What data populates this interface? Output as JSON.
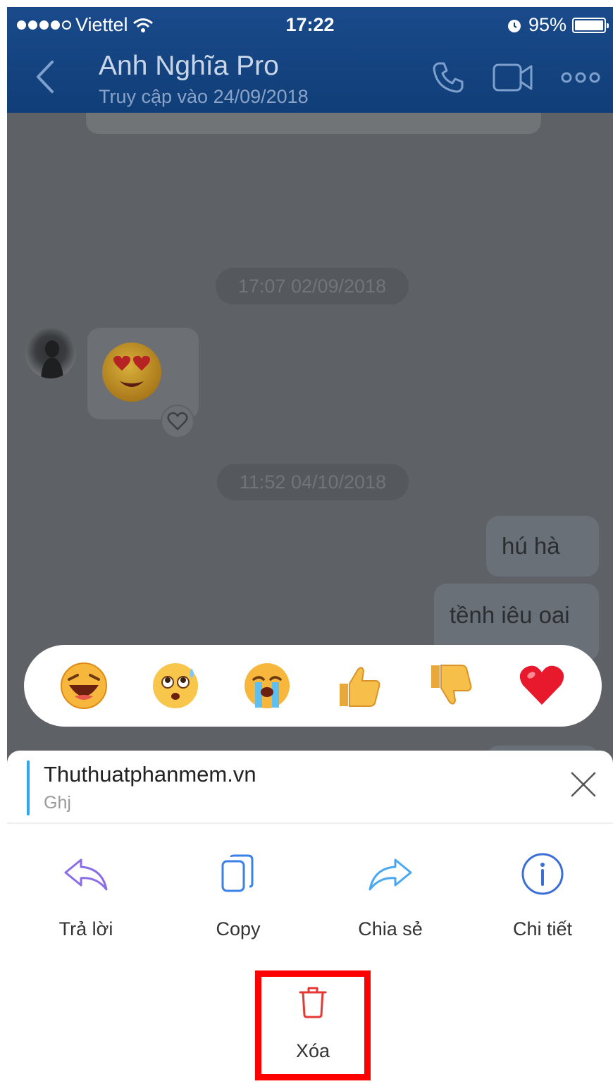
{
  "status_bar": {
    "carrier": "Viettel",
    "time": "17:22",
    "battery": "95%",
    "battery_level": 0.95,
    "icons": [
      "signal-dots-icon",
      "wifi-icon",
      "alarm-icon",
      "battery-icon"
    ]
  },
  "header": {
    "contact_name": "Anh Nghĩa Pro",
    "last_seen": "Truy cập vào 24/09/2018",
    "icons": [
      "back-chevron-icon",
      "phone-icon",
      "video-call-icon",
      "more-icon"
    ]
  },
  "chat": {
    "timestamps": [
      "17:07 02/09/2018",
      "11:52 04/10/2018"
    ],
    "incoming_sticker": "heart-eyes-emoji",
    "outgoing_messages": [
      "hú hà",
      "tềnh iêu oai"
    ]
  },
  "reactions": [
    {
      "name": "laughing-emoji"
    },
    {
      "name": "surprised-sweat-emoji"
    },
    {
      "name": "crying-emoji"
    },
    {
      "name": "thumbs-up-emoji"
    },
    {
      "name": "thumbs-down-emoji"
    },
    {
      "name": "heart-emoji"
    }
  ],
  "sheet": {
    "quote_name": "Thuthuatphanmem.vn",
    "quote_text": "Ghj",
    "actions": [
      {
        "label": "Trả lời",
        "icon": "reply-icon"
      },
      {
        "label": "Copy",
        "icon": "copy-icon"
      },
      {
        "label": "Chia sẻ",
        "icon": "share-icon"
      },
      {
        "label": "Chi tiết",
        "icon": "info-icon"
      }
    ],
    "delete_label": "Xóa",
    "delete_icon": "trash-icon"
  },
  "colors": {
    "header": "#0f3e78",
    "highlight_box": "#ff0000",
    "reply": "#8b6de8",
    "copy": "#3b82e8",
    "share": "#4aa8f0",
    "info": "#3b6fd6",
    "delete": "#e53935"
  }
}
